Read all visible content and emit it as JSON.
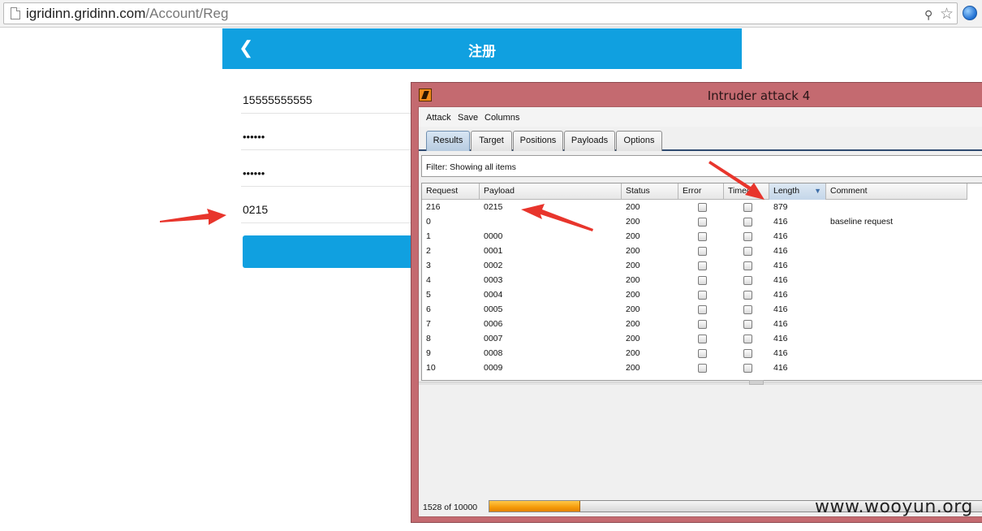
{
  "browser": {
    "url_host": "igridinn.gridinn.com",
    "url_path": "/Account/Reg",
    "page_icon": "page-icon",
    "key_icon": "key-icon",
    "star_icon": "star-icon",
    "globe_icon": "globe-icon"
  },
  "mobile": {
    "title": "注册",
    "back_icon": "chevron-left-icon",
    "phone_value": "15555555555",
    "password_value": "••••••",
    "confirm_password_value": "••••••",
    "code_value": "0215",
    "accent_color": "#10a0e0"
  },
  "intruder": {
    "window_title": "Intruder attack 4",
    "logo_icon": "burp-logo-icon",
    "menu": [
      "Attack",
      "Save",
      "Columns"
    ],
    "tabs": [
      "Results",
      "Target",
      "Positions",
      "Payloads",
      "Options"
    ],
    "active_tab": "Results",
    "filter_text": "Filter:  Showing all items",
    "columns": [
      "Request",
      "Payload",
      "Status",
      "Error",
      "Timeo...",
      "Length",
      "Comment"
    ],
    "sorted_column": "Length",
    "rows": [
      {
        "request": "216",
        "payload": "0215",
        "status": "200",
        "length": "879",
        "comment": ""
      },
      {
        "request": "0",
        "payload": "",
        "status": "200",
        "length": "416",
        "comment": "baseline request"
      },
      {
        "request": "1",
        "payload": "0000",
        "status": "200",
        "length": "416",
        "comment": ""
      },
      {
        "request": "2",
        "payload": "0001",
        "status": "200",
        "length": "416",
        "comment": ""
      },
      {
        "request": "3",
        "payload": "0002",
        "status": "200",
        "length": "416",
        "comment": ""
      },
      {
        "request": "4",
        "payload": "0003",
        "status": "200",
        "length": "416",
        "comment": ""
      },
      {
        "request": "5",
        "payload": "0004",
        "status": "200",
        "length": "416",
        "comment": ""
      },
      {
        "request": "6",
        "payload": "0005",
        "status": "200",
        "length": "416",
        "comment": ""
      },
      {
        "request": "7",
        "payload": "0006",
        "status": "200",
        "length": "416",
        "comment": ""
      },
      {
        "request": "8",
        "payload": "0007",
        "status": "200",
        "length": "416",
        "comment": ""
      },
      {
        "request": "9",
        "payload": "0008",
        "status": "200",
        "length": "416",
        "comment": ""
      },
      {
        "request": "10",
        "payload": "0009",
        "status": "200",
        "length": "416",
        "comment": ""
      }
    ],
    "progress_text": "1528 of 10000",
    "progress_fraction": 0.1528,
    "window_color": "#c46a70"
  },
  "annotation": {
    "arrow_color": "#e8352c",
    "watermark": "www.wooyun.org"
  }
}
